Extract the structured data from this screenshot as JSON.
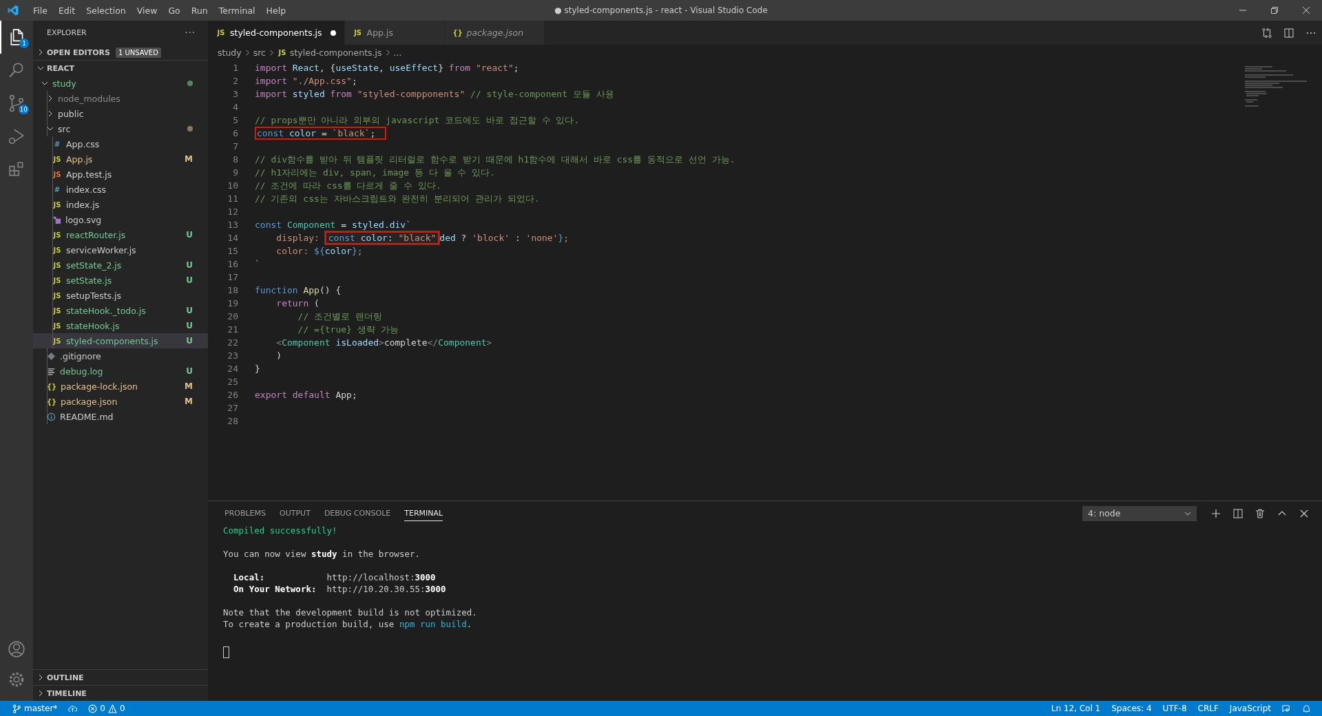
{
  "window": {
    "title": "● styled-components.js - react - Visual Studio Code"
  },
  "menu": [
    "File",
    "Edit",
    "Selection",
    "View",
    "Go",
    "Run",
    "Terminal",
    "Help"
  ],
  "activity_bar": [
    {
      "kind": "explorer",
      "badge": "1",
      "selected": true
    },
    {
      "kind": "search",
      "selected": false
    },
    {
      "kind": "source-control",
      "badge": "10",
      "selected": false
    },
    {
      "kind": "run",
      "selected": false
    },
    {
      "kind": "extensions",
      "selected": false
    }
  ],
  "sidebar": {
    "title": "EXPLORER",
    "more": "···",
    "open_editors": {
      "label": "OPEN EDITORS",
      "badge": "1 UNSAVED",
      "expanded": false
    },
    "root": {
      "label": "REACT",
      "expanded": true
    },
    "tree": [
      {
        "name": "study",
        "kind": "folder",
        "expanded": true,
        "color": "#73c991",
        "dot": {
          "color": "#4b8a5f"
        },
        "selected": false,
        "children": [
          {
            "name": "node_modules",
            "kind": "folder",
            "expanded": false,
            "color": "#8c8c8c",
            "selected": false
          },
          {
            "name": "public",
            "kind": "folder",
            "expanded": false,
            "color": "#cccccc",
            "selected": false
          },
          {
            "name": "src",
            "kind": "folder",
            "expanded": true,
            "color": "#cccccc",
            "dot": {
              "color": "#8a7a5c"
            },
            "selected": false,
            "children": [
              {
                "name": "App.css",
                "kind": "css",
                "icon": "#",
                "color": "#cccccc",
                "selected": false
              },
              {
                "name": "App.js",
                "kind": "js",
                "icon": "JS",
                "color": "#e2c08d",
                "badge": "M",
                "selected": false
              },
              {
                "name": "App.test.js",
                "kind": "test",
                "icon": "JS",
                "color": "#cccccc",
                "selected": false
              },
              {
                "name": "index.css",
                "kind": "css",
                "icon": "#",
                "color": "#cccccc",
                "selected": false
              },
              {
                "name": "index.js",
                "kind": "js",
                "icon": "JS",
                "color": "#cccccc",
                "selected": false
              },
              {
                "name": "logo.svg",
                "kind": "svg",
                "color": "#cccccc",
                "selected": false
              },
              {
                "name": "reactRouter.js",
                "kind": "js",
                "icon": "JS",
                "color": "#73c991",
                "badge": "U",
                "selected": false
              },
              {
                "name": "serviceWorker.js",
                "kind": "js",
                "icon": "JS",
                "color": "#cccccc",
                "selected": false
              },
              {
                "name": "setState_2.js",
                "kind": "js",
                "icon": "JS",
                "color": "#73c991",
                "badge": "U",
                "selected": false
              },
              {
                "name": "setState.js",
                "kind": "js",
                "icon": "JS",
                "color": "#73c991",
                "badge": "U",
                "selected": false
              },
              {
                "name": "setupTests.js",
                "kind": "js",
                "icon": "JS",
                "color": "#cccccc",
                "selected": false
              },
              {
                "name": "stateHook._todo.js",
                "kind": "js",
                "icon": "JS",
                "color": "#73c991",
                "badge": "U",
                "selected": false
              },
              {
                "name": "stateHook.js",
                "kind": "js",
                "icon": "JS",
                "color": "#73c991",
                "badge": "U",
                "selected": false
              },
              {
                "name": "styled-components.js",
                "kind": "js",
                "icon": "JS",
                "color": "#73c991",
                "badge": "U",
                "selected": true
              }
            ]
          },
          {
            "name": ".gitignore",
            "kind": "git",
            "color": "#cccccc",
            "selected": false
          },
          {
            "name": "debug.log",
            "kind": "log",
            "color": "#73c991",
            "badge": "U",
            "selected": false
          },
          {
            "name": "package-lock.json",
            "kind": "json",
            "icon": "{}",
            "color": "#e2c08d",
            "badge": "M",
            "selected": false
          },
          {
            "name": "package.json",
            "kind": "json",
            "icon": "{}",
            "color": "#e2c08d",
            "badge": "M",
            "selected": false
          },
          {
            "name": "README.md",
            "kind": "info",
            "color": "#cccccc",
            "selected": false
          }
        ]
      }
    ],
    "bottom_sections": [
      {
        "label": "OUTLINE",
        "expanded": false
      },
      {
        "label": "TIMELINE",
        "expanded": false
      }
    ]
  },
  "tabs": [
    {
      "label": "styled-components.js",
      "icon": "JS",
      "selected": true,
      "dirty": true,
      "preview": false
    },
    {
      "label": "App.js",
      "icon": "JS",
      "selected": false,
      "dirty": false,
      "preview": false
    },
    {
      "label": "package.json",
      "icon": "{}",
      "selected": false,
      "dirty": false,
      "preview": true
    }
  ],
  "breadcrumb": [
    {
      "label": "study"
    },
    {
      "label": "src"
    },
    {
      "label": "styled-components.js",
      "icon": "JS"
    },
    {
      "label": "..."
    }
  ],
  "code": [
    {
      "n": "1",
      "parts": [
        {
          "kind": "text",
          "tokens": [
            {
              "kind": "kw",
              "t": "import"
            },
            {
              "kind": "v",
              "t": " React"
            },
            {
              "kind": "p",
              "t": ", {"
            },
            {
              "kind": "v",
              "t": "useState"
            },
            {
              "kind": "p",
              "t": ", "
            },
            {
              "kind": "v",
              "t": "useEffect"
            },
            {
              "kind": "p",
              "t": "} "
            },
            {
              "kind": "kw",
              "t": "from"
            },
            {
              "kind": "s",
              "t": " \"react\""
            },
            {
              "kind": "p",
              "t": ";"
            }
          ]
        }
      ]
    },
    {
      "n": "2",
      "parts": [
        {
          "kind": "text",
          "tokens": [
            {
              "kind": "kw",
              "t": "import"
            },
            {
              "kind": "s",
              "t": " \"./App.css\""
            },
            {
              "kind": "p",
              "t": ";"
            }
          ]
        }
      ]
    },
    {
      "n": "3",
      "parts": [
        {
          "kind": "text",
          "tokens": [
            {
              "kind": "kw",
              "t": "import"
            },
            {
              "kind": "v",
              "t": " styled"
            },
            {
              "kind": "kw",
              "t": " from"
            },
            {
              "kind": "s",
              "t": " \"styled-compponents\""
            },
            {
              "kind": "cm",
              "t": " // style-component 모듈 사용"
            }
          ]
        }
      ]
    },
    {
      "n": "4"
    },
    {
      "n": "5",
      "parts": [
        {
          "kind": "text",
          "tokens": [
            {
              "kind": "cm",
              "t": "// props뿐만 아니라 외부의 javascript 코드에도 바로 접근할 수 있다."
            }
          ]
        }
      ]
    },
    {
      "n": "6",
      "parts": [
        {
          "kind": "boxed",
          "tokens": [
            {
              "kind": "st",
              "t": "const"
            },
            {
              "kind": "v",
              "t": " color"
            },
            {
              "kind": "p",
              "t": " = "
            },
            {
              "kind": "s",
              "t": "`black`"
            },
            {
              "kind": "p",
              "t": ";"
            }
          ]
        }
      ]
    },
    {
      "n": "7"
    },
    {
      "n": "8",
      "parts": [
        {
          "kind": "text",
          "tokens": [
            {
              "kind": "cm",
              "t": "// div함수를 받아 뒤 템플릿 리터럴로 함수로 받기 때문에 h1함수에 대해서 바로 css를 동적으로 선언 가능."
            }
          ]
        }
      ]
    },
    {
      "n": "9",
      "parts": [
        {
          "kind": "text",
          "tokens": [
            {
              "kind": "cm",
              "t": "// h1자리에는 div, span, image 등 다 올 수 있다."
            }
          ]
        }
      ]
    },
    {
      "n": "10",
      "parts": [
        {
          "kind": "text",
          "tokens": [
            {
              "kind": "cm",
              "t": "// 조건에 따라 css를 다르게 줄 수 있다."
            }
          ]
        }
      ]
    },
    {
      "n": "11",
      "parts": [
        {
          "kind": "text",
          "tokens": [
            {
              "kind": "cm",
              "t": "// 기존의 css는 자바스크립트와 완전히 분리되어 관리가 되었다."
            }
          ]
        }
      ]
    },
    {
      "n": "12"
    },
    {
      "n": "13",
      "parts": [
        {
          "kind": "text",
          "tokens": [
            {
              "kind": "st",
              "t": "const"
            },
            {
              "kind": "c",
              "t": " Component"
            },
            {
              "kind": "p",
              "t": " = "
            },
            {
              "kind": "v",
              "t": "styled"
            },
            {
              "kind": "p",
              "t": "."
            },
            {
              "kind": "v",
              "t": "div"
            },
            {
              "kind": "s",
              "t": "`"
            }
          ]
        }
      ]
    },
    {
      "n": "14",
      "parts": [
        {
          "kind": "text",
          "tokens": [
            {
              "kind": "s",
              "t": "    display: "
            }
          ]
        },
        {
          "kind": "hover",
          "tokens": [
            {
              "kind": "st",
              "t": "const"
            },
            {
              "kind": "v",
              "t": " color"
            },
            {
              "kind": "p",
              "t": ": "
            },
            {
              "kind": "s",
              "t": "\"black\""
            }
          ]
        },
        {
          "kind": "text",
          "tokens": [
            {
              "kind": "v",
              "t": "ded"
            },
            {
              "kind": "p",
              "t": " ? "
            },
            {
              "kind": "s",
              "t": "'block'"
            },
            {
              "kind": "p",
              "t": " : "
            },
            {
              "kind": "s",
              "t": "'none'"
            },
            {
              "kind": "st",
              "t": "}"
            },
            {
              "kind": "s",
              "t": ";"
            }
          ]
        }
      ]
    },
    {
      "n": "15",
      "parts": [
        {
          "kind": "text",
          "tokens": [
            {
              "kind": "s",
              "t": "    color: "
            },
            {
              "kind": "st",
              "t": "${"
            },
            {
              "kind": "v",
              "t": "color"
            },
            {
              "kind": "st",
              "t": "}"
            },
            {
              "kind": "s",
              "t": ";"
            }
          ]
        }
      ]
    },
    {
      "n": "16",
      "parts": [
        {
          "kind": "text",
          "tokens": [
            {
              "kind": "s",
              "t": "`"
            }
          ]
        }
      ]
    },
    {
      "n": "17"
    },
    {
      "n": "18",
      "parts": [
        {
          "kind": "text",
          "tokens": [
            {
              "kind": "st",
              "t": "function"
            },
            {
              "kind": "f",
              "t": " App"
            },
            {
              "kind": "p",
              "t": "() {"
            }
          ]
        }
      ]
    },
    {
      "n": "19",
      "parts": [
        {
          "kind": "text",
          "tokens": [
            {
              "kind": "kw",
              "t": "    return"
            },
            {
              "kind": "p",
              "t": " ("
            }
          ]
        }
      ]
    },
    {
      "n": "20",
      "parts": [
        {
          "kind": "text",
          "tokens": [
            {
              "kind": "cm",
              "t": "        // 조건별로 랜더링"
            }
          ]
        }
      ]
    },
    {
      "n": "21",
      "parts": [
        {
          "kind": "text",
          "tokens": [
            {
              "kind": "cm",
              "t": "        // ={true} 생략 가능"
            }
          ]
        }
      ]
    },
    {
      "n": "22",
      "parts": [
        {
          "kind": "text",
          "tokens": [
            {
              "kind": "tg",
              "t": "    <"
            },
            {
              "kind": "c",
              "t": "Component"
            },
            {
              "kind": "v",
              "t": " isLoaded"
            },
            {
              "kind": "tg",
              "t": ">"
            },
            {
              "kind": "p",
              "t": "complete"
            },
            {
              "kind": "tg",
              "t": "</"
            },
            {
              "kind": "c",
              "t": "Component"
            },
            {
              "kind": "tg",
              "t": ">"
            }
          ]
        }
      ]
    },
    {
      "n": "23",
      "parts": [
        {
          "kind": "text",
          "tokens": [
            {
              "kind": "p",
              "t": "    )"
            }
          ]
        }
      ]
    },
    {
      "n": "24",
      "parts": [
        {
          "kind": "text",
          "tokens": [
            {
              "kind": "p",
              "t": "}"
            }
          ]
        }
      ]
    },
    {
      "n": "25"
    },
    {
      "n": "26",
      "parts": [
        {
          "kind": "text",
          "tokens": [
            {
              "kind": "kw",
              "t": "export"
            },
            {
              "kind": "kw",
              "t": " default"
            },
            {
              "kind": "p",
              "t": " App;"
            }
          ]
        }
      ]
    },
    {
      "n": "27"
    },
    {
      "n": "28"
    }
  ],
  "panel": {
    "tabs": [
      {
        "label": "PROBLEMS",
        "selected": false
      },
      {
        "label": "OUTPUT",
        "selected": false
      },
      {
        "label": "DEBUG CONSOLE",
        "selected": false
      },
      {
        "label": "TERMINAL",
        "selected": true
      }
    ],
    "terminal_select": "4: node",
    "terminal": [
      {
        "kind": "text",
        "segments": [
          {
            "kind": "success",
            "t": "Compiled successfully!"
          }
        ]
      },
      {
        "kind": "blank"
      },
      {
        "kind": "text",
        "segments": [
          {
            "kind": "plain",
            "t": "You can now view "
          },
          {
            "kind": "bold",
            "t": "study"
          },
          {
            "kind": "plain",
            "t": " in the browser."
          }
        ]
      },
      {
        "kind": "blank"
      },
      {
        "kind": "text",
        "segments": [
          {
            "kind": "bold",
            "t": "  Local:"
          },
          {
            "kind": "plain",
            "t": "            http://localhost:"
          },
          {
            "kind": "bold",
            "t": "3000"
          }
        ]
      },
      {
        "kind": "text",
        "segments": [
          {
            "kind": "bold",
            "t": "  On Your Network:"
          },
          {
            "kind": "plain",
            "t": "  http://10.20.30.55:"
          },
          {
            "kind": "bold",
            "t": "3000"
          }
        ]
      },
      {
        "kind": "blank"
      },
      {
        "kind": "text",
        "segments": [
          {
            "kind": "plain",
            "t": "Note that the development build is not optimized."
          }
        ]
      },
      {
        "kind": "text",
        "segments": [
          {
            "kind": "plain",
            "t": "To create a production build, use "
          },
          {
            "kind": "cmd",
            "t": "npm run build"
          },
          {
            "kind": "plain",
            "t": "."
          }
        ]
      },
      {
        "kind": "blank"
      },
      {
        "kind": "cursor"
      }
    ]
  },
  "status_bar": {
    "branch": "master*",
    "errors": "0",
    "warnings": "0",
    "right": [
      "Ln 12, Col 1",
      "Spaces: 4",
      "UTF-8",
      "CRLF",
      "JavaScript"
    ]
  }
}
